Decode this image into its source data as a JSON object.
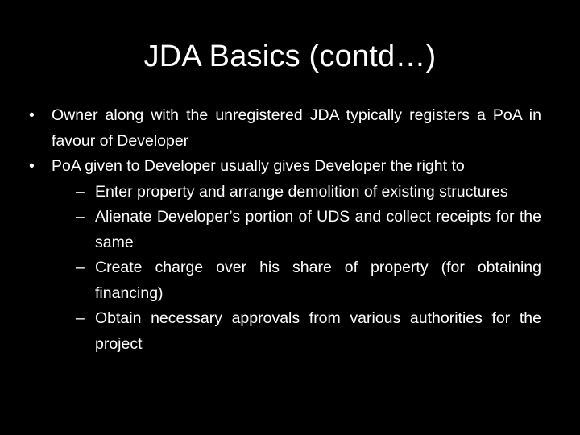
{
  "slide": {
    "title": "JDA Basics (contd…)",
    "bullet_marker": "•",
    "dash_marker": "–",
    "bullets": [
      {
        "text": "Owner along with the unregistered JDA typically registers a PoA in favour of Developer",
        "sub_items": []
      },
      {
        "text": "PoA given to Developer usually gives Developer the right to",
        "sub_items": [
          "Enter property and arrange demolition of existing structures",
          "Alienate Developer’s portion of UDS and collect receipts for the same",
          "Create charge over his share of property (for obtaining financing)",
          "Obtain necessary approvals from various authorities for the project"
        ]
      }
    ]
  },
  "colors": {
    "background": "#000000",
    "text": "#ffffff"
  }
}
